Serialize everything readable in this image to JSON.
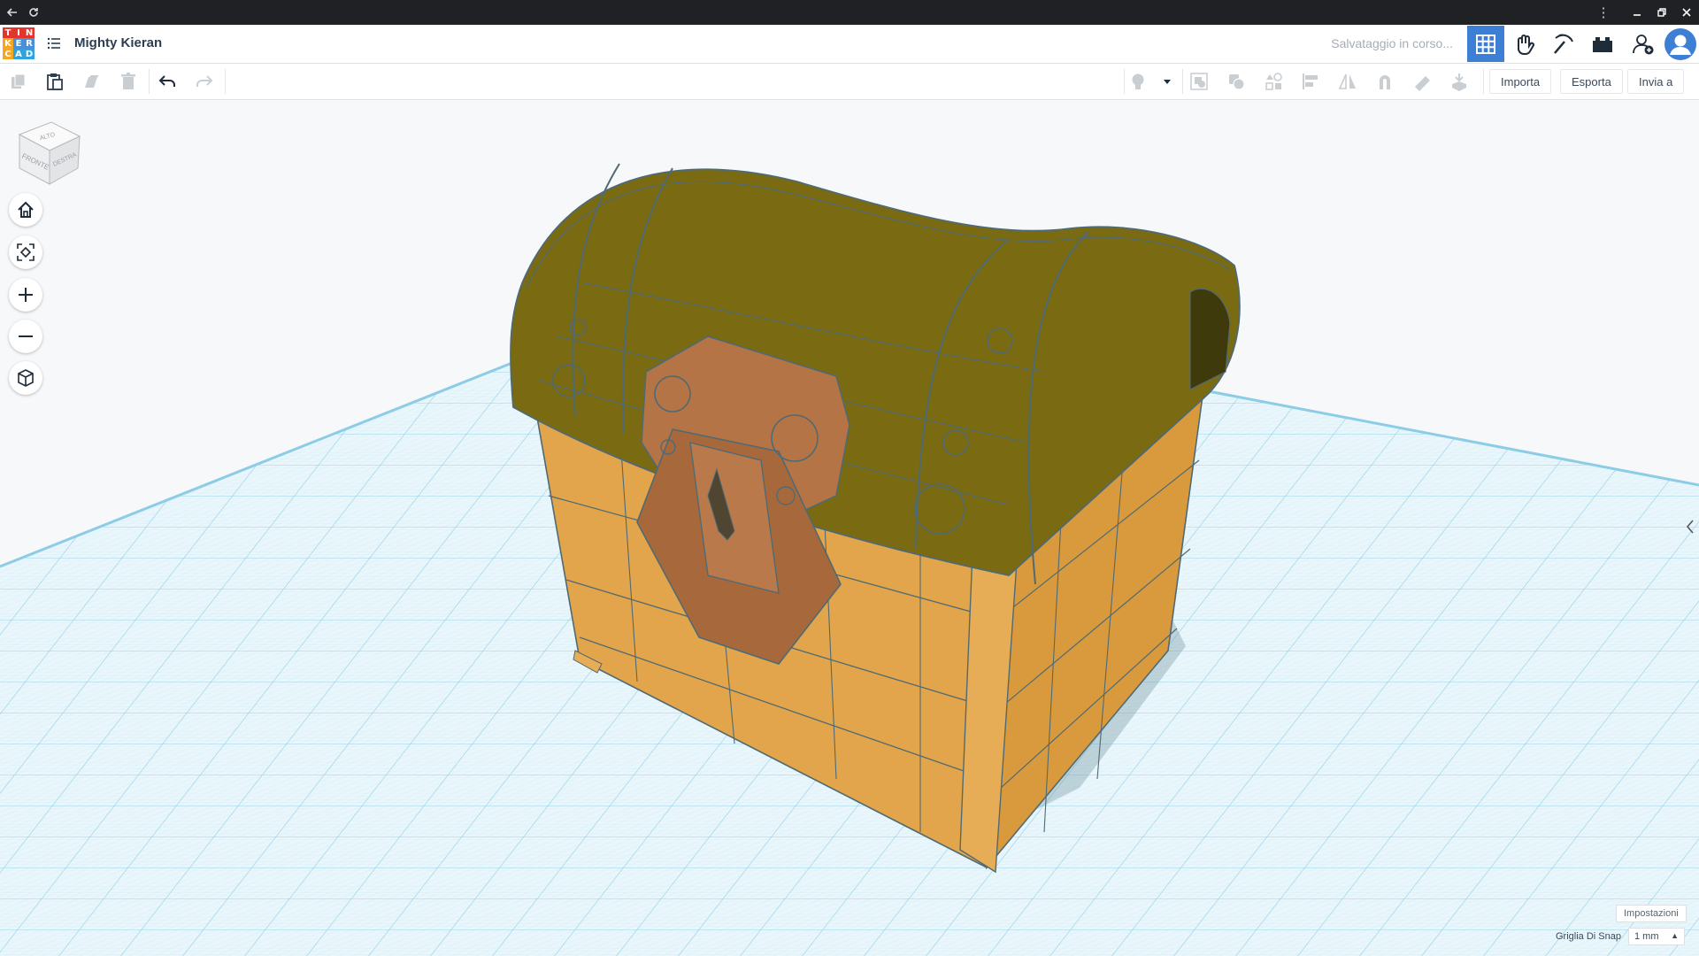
{
  "window": {
    "back_icon": "arrow-left-icon",
    "reload_icon": "reload-icon",
    "more_icon": "kebab-icon",
    "minimize_icon": "minimize-icon",
    "maximize_icon": "restore-icon",
    "close_icon": "close-icon"
  },
  "header": {
    "logo_letters": [
      "T",
      "I",
      "N",
      "K",
      "E",
      "R",
      "C",
      "A",
      "D"
    ],
    "logo_colors": [
      "#e2352b",
      "#e2352b",
      "#e2352b",
      "#f5a623",
      "#4a90d9",
      "#4a90d9",
      "#f5a623",
      "#2ea3dc",
      "#2ea3dc"
    ],
    "project_title": "Mighty Kieran",
    "save_status": "Salvataggio in corso...",
    "accent": "#3e7fd6"
  },
  "toolbar": {
    "import_label": "Importa",
    "export_label": "Esporta",
    "send_label": "Invia a"
  },
  "viewcube": {
    "top": "ALTO",
    "front": "FRONTE",
    "right": "DESTRA"
  },
  "footer": {
    "settings_label": "Impostazioni",
    "snap_label": "Griglia Di Snap",
    "snap_value": "1 mm"
  },
  "colors": {
    "chest_body": "#e2a54b",
    "chest_lid": "#7a6a12",
    "lock": "#b47445",
    "grid_line": "#aeddee",
    "grid_bg": "#e9f6fb"
  }
}
